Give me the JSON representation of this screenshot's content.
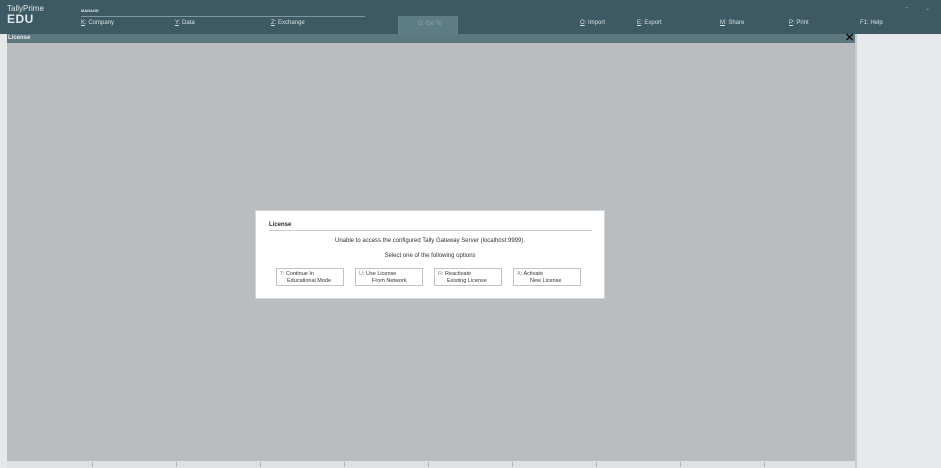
{
  "brand": {
    "product": "TallyPrime",
    "edition": "EDU"
  },
  "menubar": {
    "manage_label": "MANAGE",
    "company": {
      "key": "K",
      "text": ": Company"
    },
    "data": {
      "key": "Y",
      "text": ": Data"
    },
    "exchange": {
      "key": "Z",
      "text": ": Exchange"
    },
    "goto": "G: Go To",
    "import": {
      "key": "O",
      "text": ": Import"
    },
    "export": {
      "key": "E",
      "text": ": Export"
    },
    "share": {
      "key": "M",
      "text": ": Share"
    },
    "print": {
      "key": "P",
      "text": ": Print"
    },
    "help": "F1: Help"
  },
  "window_controls": {
    "minimize": "–",
    "restore": "⌄"
  },
  "screen": {
    "title": "License",
    "close": "✕"
  },
  "dialog": {
    "title": "License",
    "message": "Unable to access the configured Tally Gateway Server (localhost:9999).",
    "prompt": "Select one of the following options",
    "options": [
      {
        "key": "T",
        "line1": "Continue In",
        "line2": "Educational Mode"
      },
      {
        "key": "U",
        "line1": "Use License",
        "line2": "From Network"
      },
      {
        "key": "R",
        "line1": "Reactivate",
        "line2": "Existing License"
      },
      {
        "key": "A",
        "line1": "Activate",
        "line2": "New License"
      }
    ]
  },
  "colors": {
    "topbar": "#3d5a64",
    "titlebar": "#5e7880",
    "workspace": "#b9bdbf",
    "dialog": "#ffffff"
  }
}
